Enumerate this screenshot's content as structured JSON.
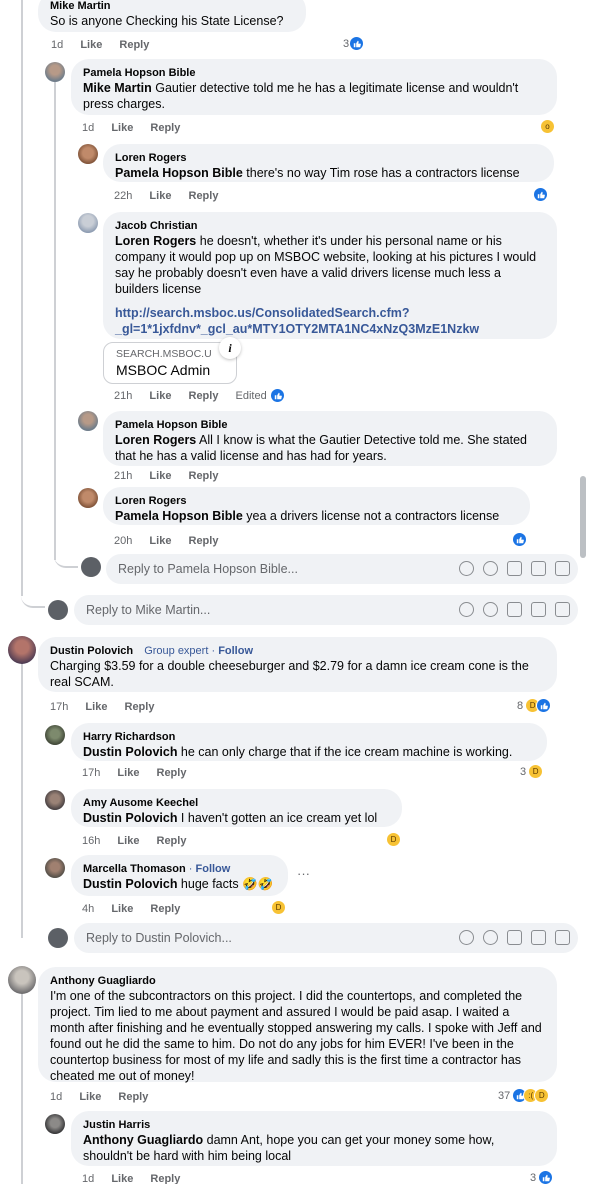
{
  "colors": {
    "accent": "#1b74e4",
    "bubble": "#f0f2f5",
    "meta": "#65676b"
  },
  "common": {
    "like": "Like",
    "reply": "Reply",
    "edited": "Edited",
    "follow": "Follow"
  },
  "c1": {
    "name": "Mike Martin",
    "text": "So is anyone Checking his State License?",
    "time": "1d",
    "count": "3"
  },
  "c1r1": {
    "name": "Pamela Hopson Bible",
    "mention": "Mike Martin",
    "text": " Gautier detective told me he has a legitimate license and wouldn't press charges.",
    "time": "1d"
  },
  "c1r2": {
    "name": "Loren Rogers",
    "mention": "Pamela Hopson Bible",
    "text": " there's no way Tim rose has a contractors license",
    "time": "22h"
  },
  "c1r3": {
    "name": "Jacob Christian",
    "mention": "Loren Rogers",
    "text": " he doesn't, whether it's under his personal name or his company it would pop up on MSBOC website, looking at his pictures I would say he probably doesn't even have a valid drivers license much less a builders license",
    "link1": "http://search.msboc.us/ConsolidatedSearch.cfm?",
    "link2": "_gl=1*1jxfdnv*_gcl_au*MTY1OTY2MTA1NC4xNzQ3MzE1Nzkw",
    "preview_domain": "SEARCH.MSBOC.U",
    "preview_title": "MSBOC Admin",
    "time": "21h"
  },
  "c1r4": {
    "name": "Pamela Hopson Bible",
    "mention": "Loren Rogers",
    "text": " All I know is what the Gautier Detective told me. She stated that he has a valid license and has had for years.",
    "time": "21h"
  },
  "c1r5": {
    "name": "Loren Rogers",
    "mention": "Pamela Hopson Bible",
    "text": " yea a drivers license not a contractors license",
    "time": "20h"
  },
  "reply1": {
    "placeholder": "Reply to Pamela Hopson Bible..."
  },
  "reply2": {
    "placeholder": "Reply to Mike Martin..."
  },
  "c2": {
    "name": "Dustin Polovich",
    "badge": "Group expert",
    "text": "Charging $3.59 for a double cheeseburger and $2.79 for a damn ice cream cone is the real SCAM.",
    "time": "17h",
    "count": "8"
  },
  "c2r1": {
    "name": "Harry Richardson",
    "mention": "Dustin Polovich",
    "text": " he can only charge that if the ice cream machine is working.",
    "time": "17h",
    "count": "3"
  },
  "c2r2": {
    "name": "Amy Ausome Keechel",
    "mention": "Dustin Polovich",
    "text": " I haven't gotten an ice cream yet lol",
    "time": "16h"
  },
  "c2r3": {
    "name": "Marcella Thomason",
    "mention": "Dustin Polovich",
    "text": " huge facts 🤣🤣",
    "time": "4h",
    "more": "···"
  },
  "reply3": {
    "placeholder": "Reply to Dustin Polovich..."
  },
  "c3": {
    "name": "Anthony Guagliardo",
    "text": "I'm one of the subcontractors on this project. I did the countertops, and completed the project. Tim lied to me about payment and assured I would be paid asap. I waited a month after finishing and he eventually stopped answering my calls. I spoke with Jeff and found out he did the same to him. Do not do any jobs for him EVER! I've been in the countertop business for most of my life and sadly this is the first time a contractor has cheated me out of money!",
    "time": "1d",
    "count": "37"
  },
  "c3r1": {
    "name": "Justin Harris",
    "mention": "Anthony Guagliardo",
    "text": " damn Ant, hope you can get your money some how, shouldn't be hard with him being local",
    "time": "1d",
    "count": "3"
  }
}
